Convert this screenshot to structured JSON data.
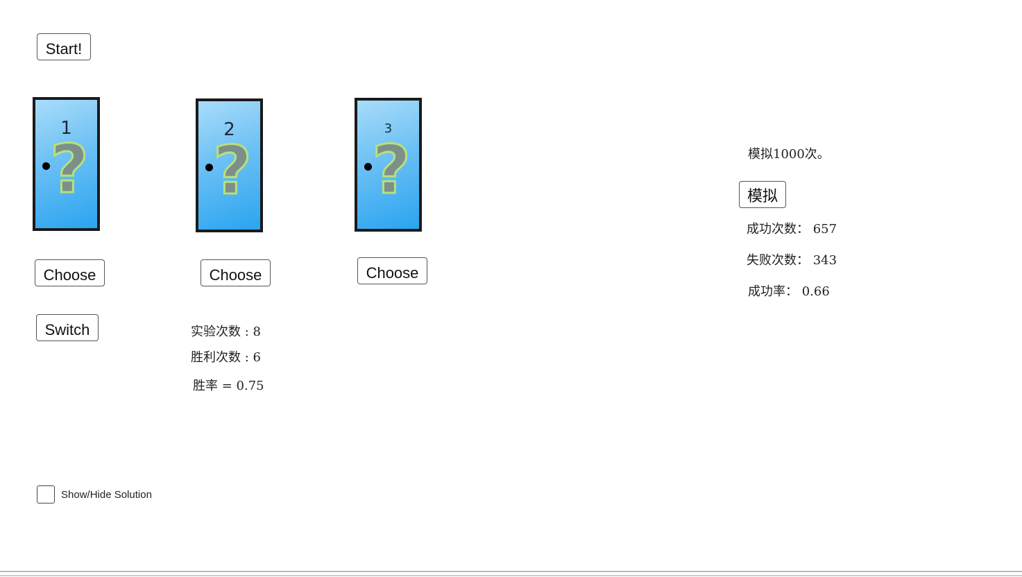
{
  "start_button": "Start!",
  "doors": [
    {
      "number": "1"
    },
    {
      "number": "2"
    },
    {
      "number": "3"
    }
  ],
  "door_icon": "question-mark",
  "choose_buttons": [
    "Choose",
    "Choose",
    "Choose"
  ],
  "switch_button": "Switch",
  "stats": {
    "trials": "实验次数 : 8",
    "wins": "胜利次数 : 6",
    "rate": "胜率 = 0.75"
  },
  "simulation": {
    "title": "模拟1000次。",
    "button": "模拟",
    "success": "成功次数： 657",
    "fail": "失败次数： 343",
    "rate": "成功率： 0.66"
  },
  "solution_toggle": {
    "label": "Show/Hide Solution",
    "checked": false
  }
}
